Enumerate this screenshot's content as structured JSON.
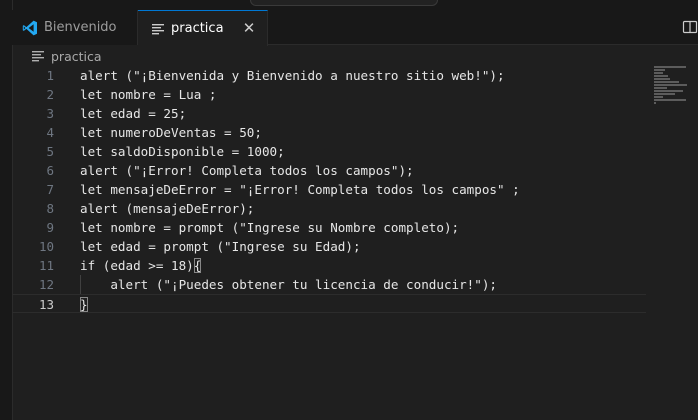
{
  "tabs": [
    {
      "label": "Bienvenido",
      "active": false
    },
    {
      "label": "practica",
      "active": true
    }
  ],
  "breadcrumb": {
    "file": "practica"
  },
  "editor": {
    "current_line": 13,
    "lines": [
      {
        "number": "1",
        "text": "alert (\"¡Bienvenida y Bienvenido a nuestro sitio web!\");"
      },
      {
        "number": "2",
        "text": "let nombre = Lua ;"
      },
      {
        "number": "3",
        "text": "let edad = 25;"
      },
      {
        "number": "4",
        "text": "let numeroDeVentas = 50;"
      },
      {
        "number": "5",
        "text": "let saldoDisponible = 1000;"
      },
      {
        "number": "6",
        "text": "alert (\"¡Error! Completa todos los campos\");"
      },
      {
        "number": "7",
        "text": "let mensajeDeError = \"¡Error! Completa todos los campos\" ;"
      },
      {
        "number": "8",
        "text": "alert (mensajeDeError);"
      },
      {
        "number": "9",
        "text": "let nombre = prompt (\"Ingrese su Nombre completo);"
      },
      {
        "number": "10",
        "text": "let edad = prompt (\"Ingrese su Edad);"
      },
      {
        "number": "11",
        "text": "if (edad >= 18)",
        "trailing_brace": "{"
      },
      {
        "number": "12",
        "text": "    alert (\"¡Puedes obtener tu licencia de conducir!\");"
      },
      {
        "number": "13",
        "text": "",
        "trailing_brace": "}"
      }
    ]
  },
  "colors": {
    "editor_bg": "#1f1f1f",
    "tabbar_bg": "#181818",
    "active_tab_border": "#0078d4",
    "text": "#e6e6e6",
    "line_number": "#6e7681",
    "vscode_blue": "#23a9f2"
  },
  "icons": {
    "welcome_tab": "vscode-logo-icon",
    "practica_tab": "file-lines-icon",
    "close": "close-icon",
    "split": "split-editor-icon"
  }
}
